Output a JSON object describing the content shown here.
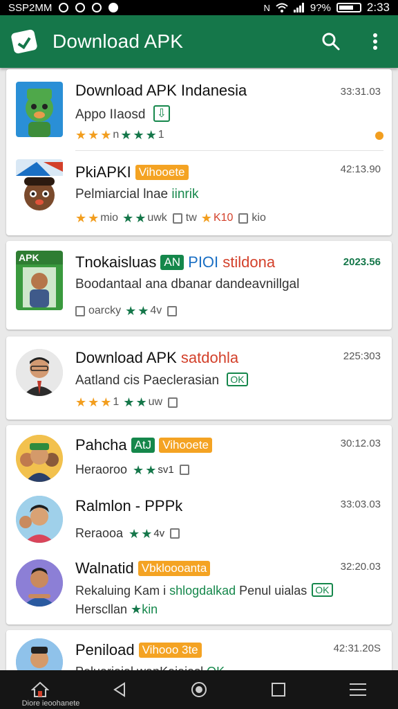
{
  "status_bar": {
    "left_text": "SSP2MM",
    "battery": "9?%",
    "time": "2:33"
  },
  "app_bar": {
    "title": "Download APK"
  },
  "colors": {
    "brand_green": "#15774a",
    "accent_orange": "#f29e1f"
  },
  "icons": [
    "app-logo-icon",
    "search-icon",
    "more-vert-icon",
    "star-icon",
    "thumbs-up-icon",
    "back-icon",
    "home-icon",
    "recents-icon",
    "menu-icon"
  ],
  "items": [
    {
      "title": "Download APK Indanesia",
      "subtitle": "Appo IIaosd",
      "meta_text": "n",
      "meta_end": "1",
      "time": "33:31.03"
    },
    {
      "title": "PkiAPKI",
      "badge": "Vihooete",
      "subtitle": "Pelmiarcial lnae",
      "subtitle_tag": "iinrik",
      "meta_a": "mio",
      "meta_b": "uwk",
      "meta_c": "tw",
      "meta_d": "K10",
      "meta_e": "kio",
      "time": "42:13.90"
    },
    {
      "title": "Tnokaisluas",
      "badge": "AN",
      "title_blue": "PIOI",
      "title_red": "stildona",
      "subtitle": "Boodantaal ana dbanar dandeavnillgal",
      "meta_text": "oarcky",
      "meta_b": "4v",
      "time": "2023.56"
    },
    {
      "title": "Download APK",
      "title_red": "satdohla",
      "subtitle": "Aatland cis Paeclerasian",
      "subtitle_tag": "OK",
      "meta_text": "1",
      "meta_b": "uw",
      "time": "225:303"
    },
    {
      "title": "Pahcha",
      "badge_green": "AtJ",
      "badge": "Vihooete",
      "subtitle": "Heraoroo",
      "meta_b": "sv1",
      "time": "30:12.03"
    },
    {
      "title": "Ralmlon - PPPk",
      "subtitle": "Reraooa",
      "meta_b": "4v",
      "time": "33:03.03"
    },
    {
      "title": "Walnatid",
      "badge": "Vbkloooanta",
      "subtitle": "Rekaluing Kam i",
      "subtitle_green": "shlogdalkad",
      "subtitle_end": "Penul uialas",
      "subtitle_tag": "OK",
      "extra_line": "Herscllan",
      "extra_green": "kin",
      "time": "32:20.03"
    },
    {
      "title": "Peniload",
      "badge": "Vihooo 3te",
      "subtitle": "Peluariaial wanKaiaiasl",
      "subtitle_tag": "OK",
      "time": "42:31.20S"
    }
  ],
  "nav": {
    "home_label": "Diore ieoohanete"
  }
}
